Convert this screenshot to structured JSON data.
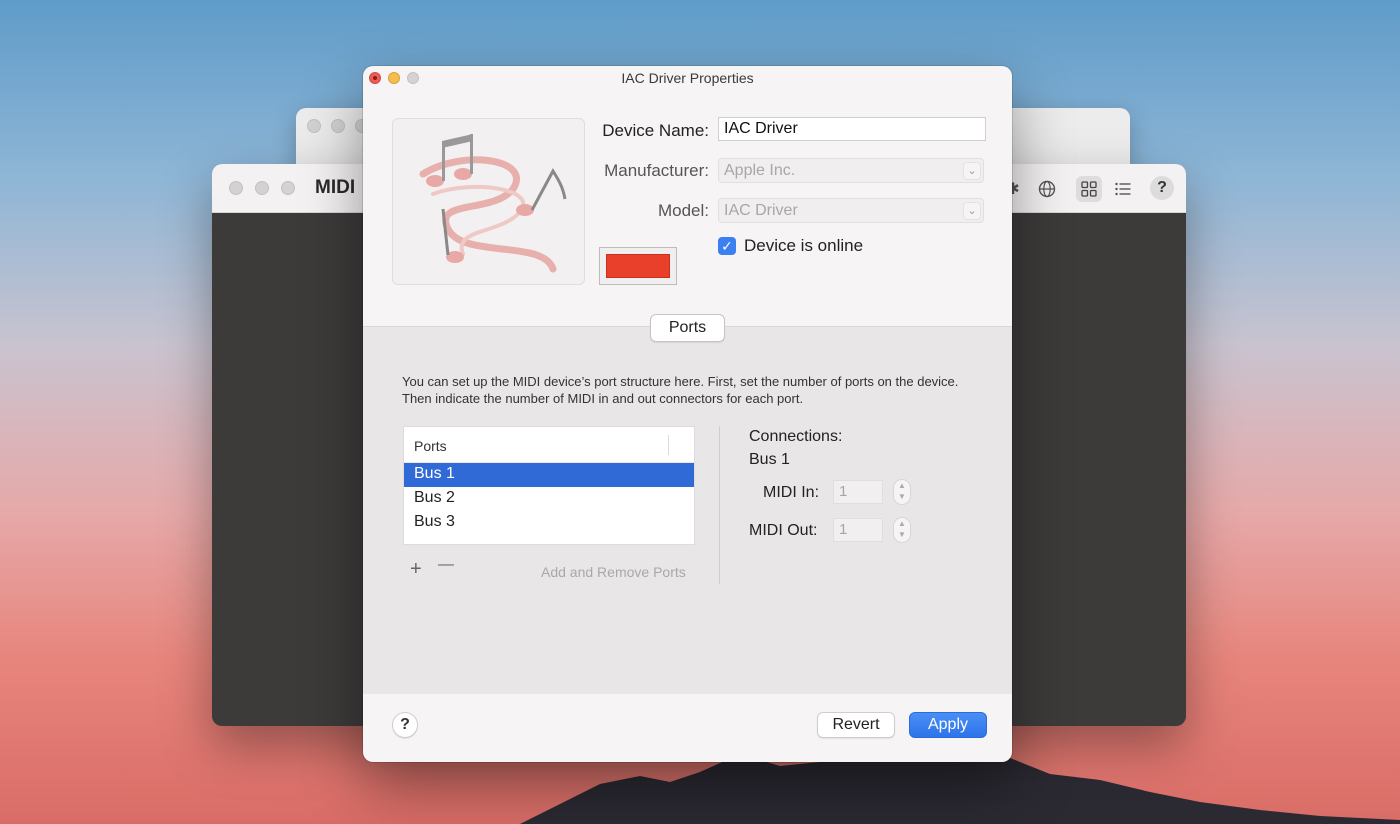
{
  "colors": {
    "accent": "#2f6ad6",
    "device_color": "#e8402b"
  },
  "background_window": {
    "title": "MIDI",
    "toolbar_icons": [
      "bluetooth-icon",
      "globe-icon",
      "grid-view-icon",
      "list-view-icon",
      "help-icon"
    ],
    "help_label": "?"
  },
  "dialog": {
    "title": "IAC Driver Properties",
    "fields": {
      "device_name_label": "Device Name:",
      "device_name_value": "IAC Driver",
      "manufacturer_label": "Manufacturer:",
      "manufacturer_value": "Apple Inc.",
      "model_label": "Model:",
      "model_value": "IAC Driver"
    },
    "online": {
      "label": "Device is online",
      "checked": true,
      "check_glyph": "✓"
    },
    "tab_label": "Ports",
    "description": "You can set up the MIDI device’s port structure here. First, set the number of ports on the device. Then indicate the number of MIDI in and out connectors for each port.",
    "ports_table": {
      "header": "Ports",
      "rows": [
        "Bus 1",
        "Bus 2",
        "Bus 3"
      ],
      "selected_index": 0
    },
    "add_glyph": "+",
    "remove_glyph": "—",
    "add_remove_label": "Add and Remove Ports",
    "connections": {
      "title": "Connections:",
      "port": "Bus 1",
      "midi_in_label": "MIDI In:",
      "midi_in_value": "1",
      "midi_out_label": "MIDI Out:",
      "midi_out_value": "1"
    },
    "help_label": "?",
    "revert_label": "Revert",
    "apply_label": "Apply"
  }
}
